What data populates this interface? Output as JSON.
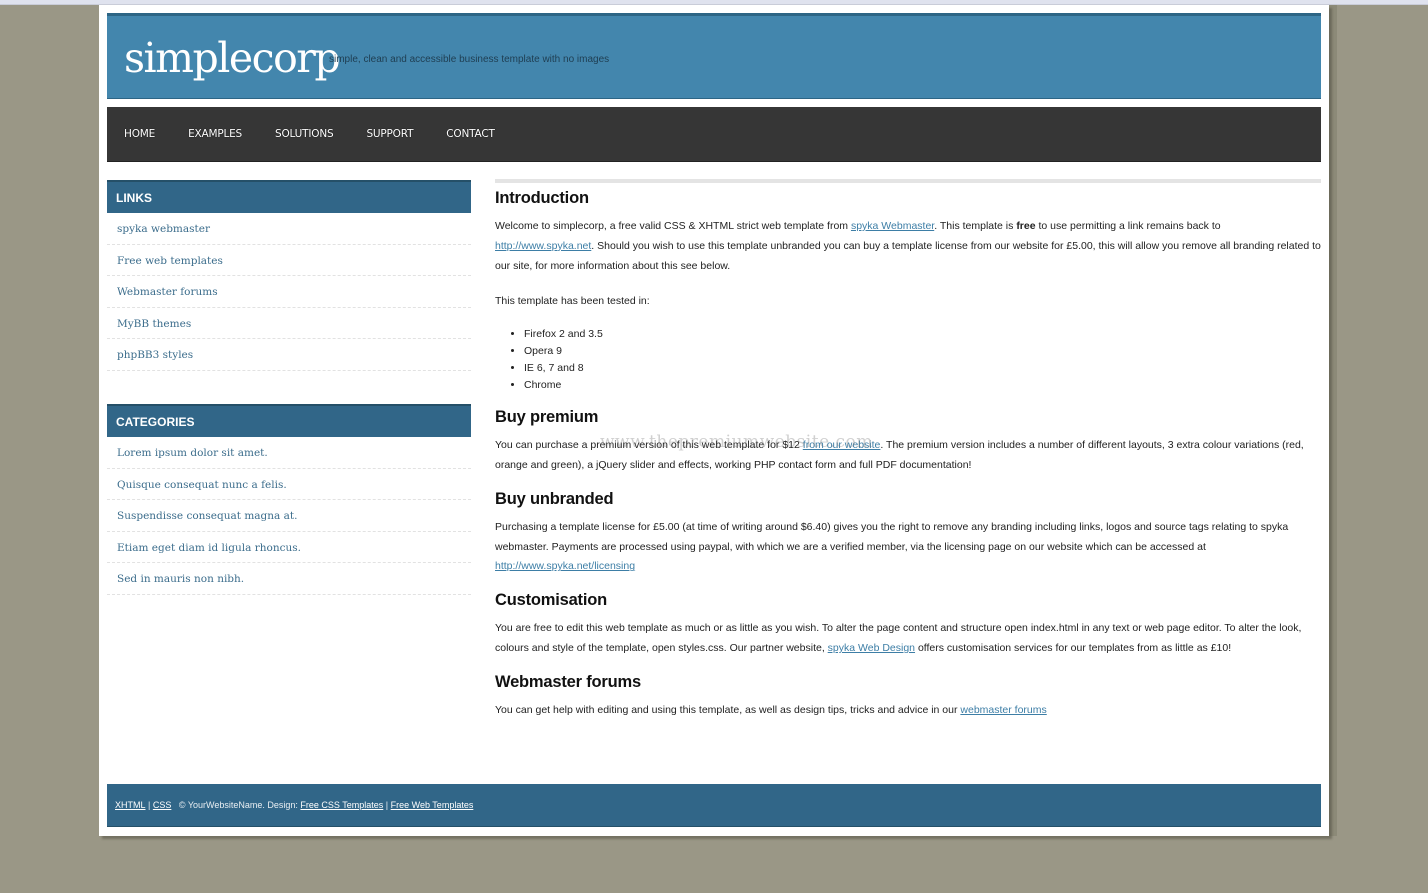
{
  "header": {
    "logo": "simplecorp",
    "tagline": "simple, clean and accessible business template with no images"
  },
  "nav": {
    "items": [
      {
        "label": "HOME"
      },
      {
        "label": "EXAMPLES"
      },
      {
        "label": "SOLUTIONS"
      },
      {
        "label": "SUPPORT"
      },
      {
        "label": "CONTACT"
      }
    ]
  },
  "sidebar": {
    "links": {
      "title": "LINKS",
      "items": [
        {
          "label": "spyka webmaster"
        },
        {
          "label": "Free web templates"
        },
        {
          "label": "Webmaster forums"
        },
        {
          "label": "MyBB themes"
        },
        {
          "label": "phpBB3 styles"
        }
      ]
    },
    "categories": {
      "title": "CATEGORIES",
      "items": [
        {
          "label": "Lorem ipsum dolor sit amet."
        },
        {
          "label": "Quisque consequat nunc a felis."
        },
        {
          "label": "Suspendisse consequat magna at."
        },
        {
          "label": "Etiam eget diam id ligula rhoncus."
        },
        {
          "label": "Sed in mauris non nibh."
        }
      ]
    }
  },
  "main": {
    "intro": {
      "heading": "Introduction",
      "p1_a": "Welcome to simplecorp, a free valid CSS & XHTML strict web template from ",
      "p1_link1": "spyka Webmaster",
      "p1_b": ". This template is ",
      "p1_bold": "free",
      "p1_c": " to use permitting a link remains back to ",
      "p1_link2": "http://www.spyka.net",
      "p1_d": ". Should you wish to use this template unbranded you can buy a template license from our website for £5.00, this will allow you remove all branding related to our site, for more information about this see below.",
      "tested_label": "This template has been tested in:",
      "browsers": [
        "Firefox 2 and 3.5",
        "Opera 9",
        "IE 6, 7 and 8",
        "Chrome"
      ]
    },
    "premium": {
      "heading": "Buy premium",
      "p_a": "You can purchase a premium version of this web template for $12 ",
      "p_link": "from our website",
      "p_b": ". The premium version includes a number of different layouts, 3 extra colour variations (red, orange and green), a jQuery slider and effects, working PHP contact form and full PDF documentation!"
    },
    "unbranded": {
      "heading": "Buy unbranded",
      "p_a": "Purchasing a template license for £5.00 (at time of writing around $6.40) gives you the right to remove any branding including links, logos and source tags relating to spyka webmaster. Payments are processed using paypal, with which we are a verified member, via the licensing page on our website which can be accessed at ",
      "p_link": "http://www.spyka.net/licensing"
    },
    "customisation": {
      "heading": "Customisation",
      "p_a": "You are free to edit this web template as much or as little as you wish. To alter the page content and structure open index.html in any text or web page editor. To alter the look, colours and style of the template, open styles.css. Our partner website, ",
      "p_link": "spyka Web Design",
      "p_b": " offers customisation services for our templates from as little as £10!"
    },
    "forums": {
      "heading": "Webmaster forums",
      "p_a": "You can get help with editing and using this template, as well as design tips, tricks and advice in our ",
      "p_link": "webmaster forums"
    }
  },
  "footer": {
    "xhtml": "XHTML",
    "sep1": " | ",
    "css": "CSS",
    "copyright": "   © YourWebsiteName. Design: ",
    "link1": "Free CSS Templates",
    "sep2": " | ",
    "link2": "Free Web Templates"
  },
  "watermark": "www.thepremiumwebsite.com"
}
